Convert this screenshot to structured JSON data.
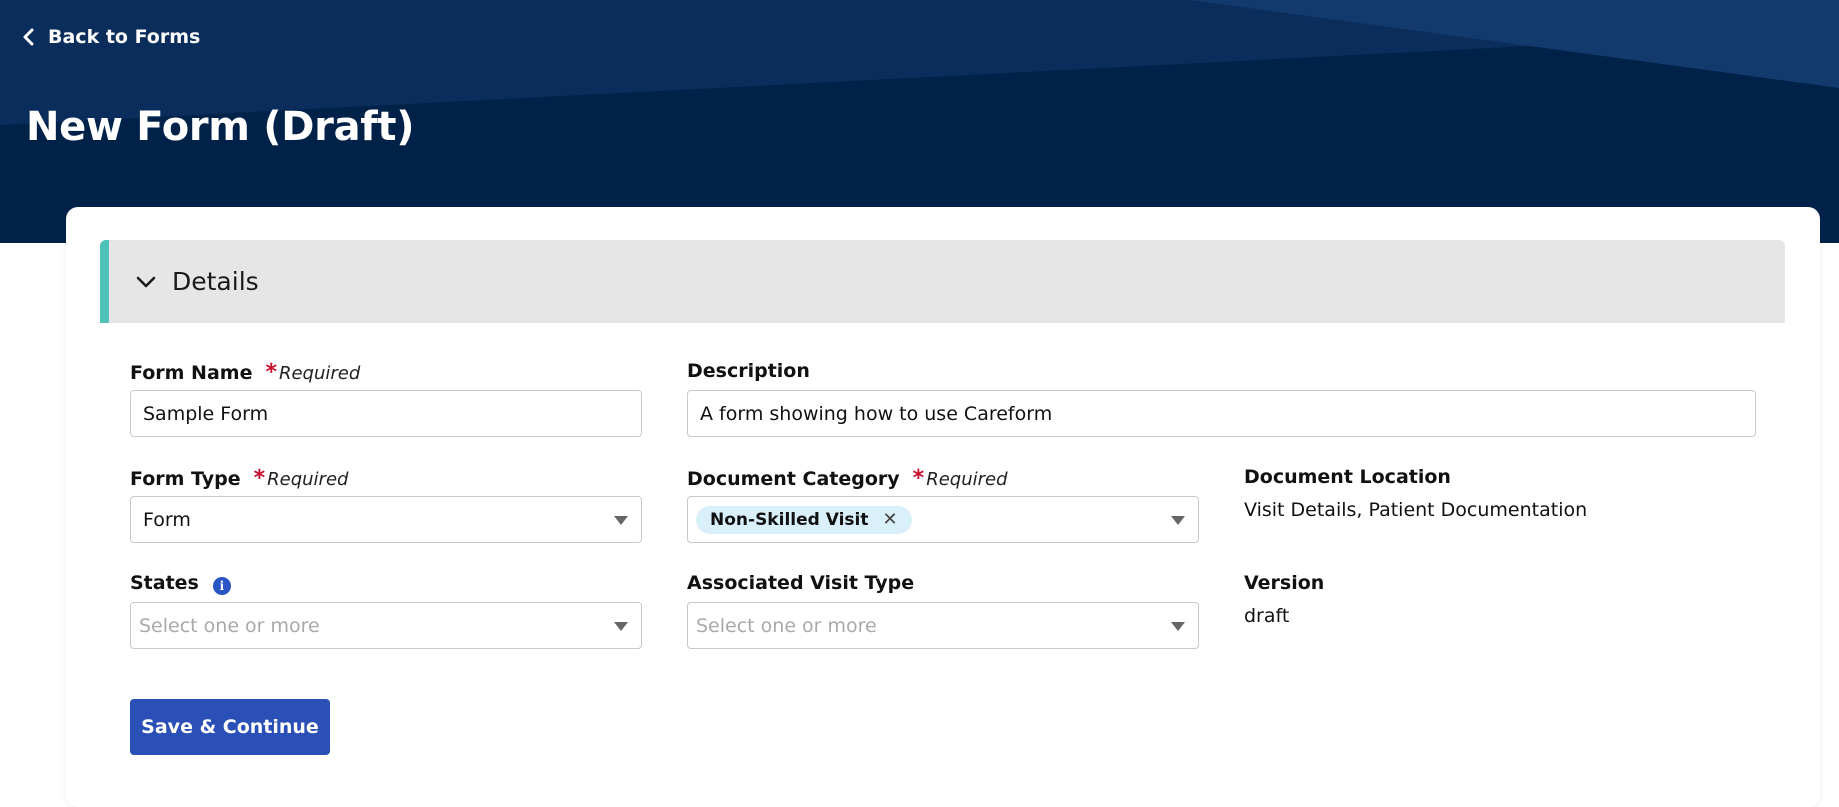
{
  "header": {
    "back_label": "Back to Forms",
    "title": "New Form (Draft)"
  },
  "section": {
    "title": "Details",
    "expanded": true
  },
  "fields": {
    "form_name": {
      "label": "Form Name",
      "required_text": "Required",
      "value": "Sample Form"
    },
    "description": {
      "label": "Description",
      "value": "A form showing how to use Careform"
    },
    "form_type": {
      "label": "Form Type",
      "required_text": "Required",
      "value": "Form"
    },
    "document_category": {
      "label": "Document Category",
      "required_text": "Required",
      "chips": [
        "Non-Skilled Visit"
      ]
    },
    "document_location": {
      "label": "Document Location",
      "value": "Visit Details, Patient Documentation"
    },
    "states": {
      "label": "States",
      "placeholder": "Select one or more"
    },
    "associated_visit_type": {
      "label": "Associated Visit Type",
      "placeholder": "Select one or more"
    },
    "version": {
      "label": "Version",
      "value": "draft"
    }
  },
  "actions": {
    "save_label": "Save & Continue"
  },
  "icons": {
    "back": "chevron-left-icon",
    "section_toggle": "chevron-down-icon",
    "info": "info-icon",
    "chip_remove": "close-icon",
    "dropdown": "caret-down-icon"
  },
  "colors": {
    "header_bg": "#002249",
    "accent": "#4fc1b7",
    "primary_button": "#2a4fb6",
    "required_star": "#c8102e",
    "chip_bg": "#d9f0fb"
  }
}
